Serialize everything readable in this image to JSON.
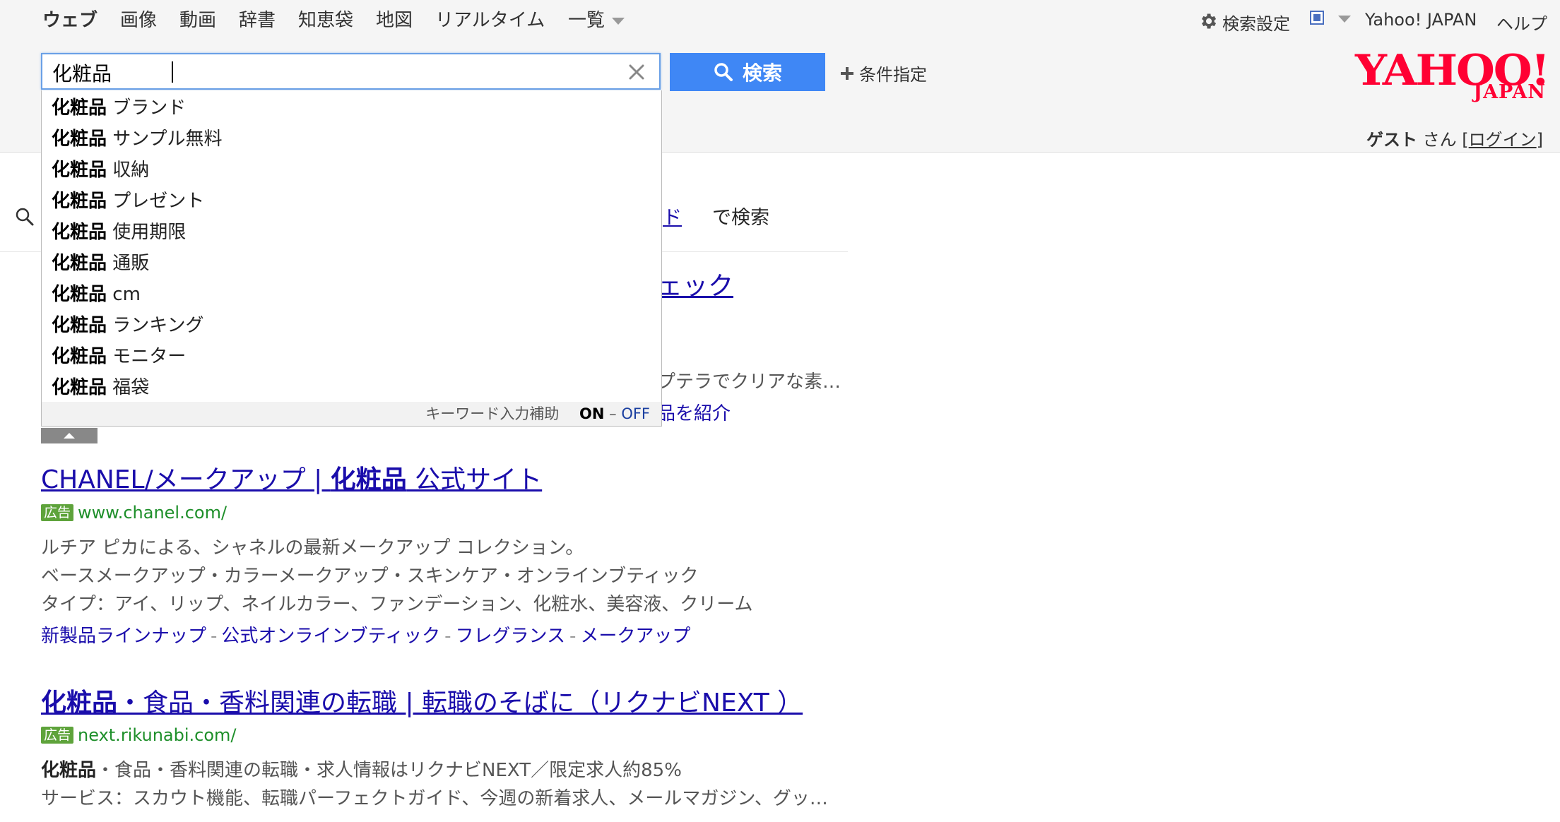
{
  "nav": {
    "tabs": [
      {
        "label": "ウェブ",
        "active": true
      },
      {
        "label": "画像"
      },
      {
        "label": "動画"
      },
      {
        "label": "辞書"
      },
      {
        "label": "知恵袋"
      },
      {
        "label": "地図"
      },
      {
        "label": "リアルタイム"
      },
      {
        "label": "一覧"
      }
    ]
  },
  "header": {
    "settings_label": "検索設定",
    "portal_label": "Yahoo! JAPAN",
    "help_label": "ヘルプ",
    "logo_main": "YAHOO!",
    "logo_sub": "JAPAN",
    "guest_name": "ゲスト",
    "guest_suffix": "さん [",
    "login_label": "ログイン",
    "bracket_close": "]"
  },
  "search": {
    "query": "化粧品 ",
    "button_label": "検索",
    "condition_label": "条件指定"
  },
  "suggest": {
    "items": [
      {
        "bold": "化粧品",
        "rest": "ブランド"
      },
      {
        "bold": "化粧品",
        "rest": "サンプル無料"
      },
      {
        "bold": "化粧品",
        "rest": "収納"
      },
      {
        "bold": "化粧品",
        "rest": "プレゼント"
      },
      {
        "bold": "化粧品",
        "rest": "使用期限"
      },
      {
        "bold": "化粧品",
        "rest": "通販"
      },
      {
        "bold": "化粧品",
        "rest": "cm"
      },
      {
        "bold": "化粧品",
        "rest": "ランキング"
      },
      {
        "bold": "化粧品",
        "rest": "モニター"
      },
      {
        "bold": "化粧品",
        "rest": "福袋"
      }
    ],
    "footer_label": "キーワード入力補助",
    "on_label": "ON",
    "dash": "–",
    "off_label": "OFF"
  },
  "partial": {
    "row_link": "ド",
    "row_suffix": "で検索",
    "title_fragment": "ェック",
    "desc_fragment": "プテラでクリアな素…",
    "sublink_fragment": "品を紹介"
  },
  "results": [
    {
      "title_pre": "CHANEL/メークアップ | ",
      "title_bold": "化粧品",
      "title_post": " 公式サイト",
      "ad_label": "広告",
      "url": "www.chanel.com/",
      "desc": [
        "ルチア ピカによる、シャネルの最新メークアップ コレクション。",
        "ベースメークアップ・カラーメークアップ・スキンケア・オンラインブティック",
        "タイプ：アイ、リップ、ネイルカラー、ファンデーション、化粧水、美容液、クリーム"
      ],
      "sublinks": [
        "新製品ラインナップ",
        "公式オンラインブティック",
        "フレグランス",
        "メークアップ"
      ],
      "separator": "-"
    },
    {
      "title_bold": "化粧品",
      "title_post": "・食品・香料関連の転職 | 転職のそばに（リクナビNEXT ）",
      "ad_label": "広告",
      "url": "next.rikunabi.com/",
      "desc_bold": "化粧品",
      "desc1_post": "・食品・香料関連の転職・求人情報はリクナビNEXT／限定求人約85%",
      "desc2": "サービス：スカウト機能、転職パーフェクトガイド、今週の新着求人、メールマガジン、グッ…"
    }
  ]
}
